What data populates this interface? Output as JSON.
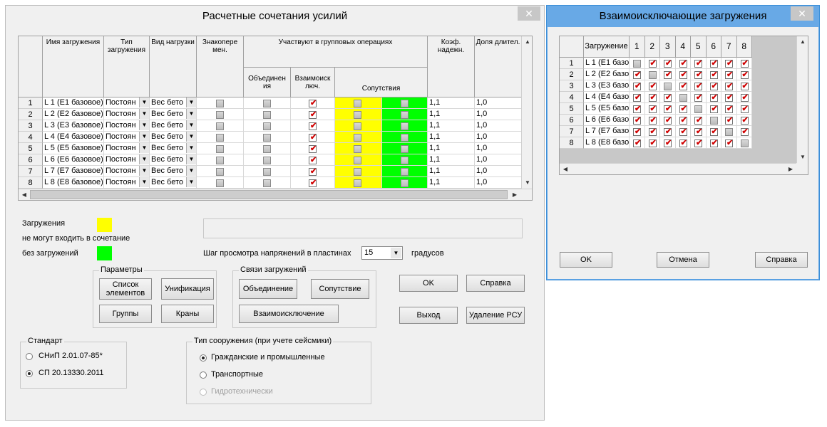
{
  "main": {
    "title": "Расчетные сочетания усилий",
    "close": "✕",
    "headers": {
      "name": "Имя загружения",
      "type": "Тип загружения",
      "kind": "Вид нагрузки",
      "sign": "Знакопере мен.",
      "group": "Участвуют в групповых операциях",
      "union": "Объединен ия",
      "excl": "Взаимоиск люч.",
      "accomp": "Сопутствия",
      "coef": "Коэф. надежн.",
      "dur": "Доля длител."
    },
    "rows": [
      {
        "num": "1",
        "name": "L 1 (E1 базовое)",
        "type": "Постоян",
        "kind": "Вес бето",
        "coef": "1,1",
        "dur": "1,0"
      },
      {
        "num": "2",
        "name": "L 2 (E2 базовое)",
        "type": "Постоян",
        "kind": "Вес бето",
        "coef": "1,1",
        "dur": "1,0"
      },
      {
        "num": "3",
        "name": "L 3 (E3 базовое)",
        "type": "Постоян",
        "kind": "Вес бето",
        "coef": "1,1",
        "dur": "1,0"
      },
      {
        "num": "4",
        "name": "L 4 (E4 базовое)",
        "type": "Постоян",
        "kind": "Вес бето",
        "coef": "1,1",
        "dur": "1,0"
      },
      {
        "num": "5",
        "name": "L 5 (E5 базовое)",
        "type": "Постоян",
        "kind": "Вес бето",
        "coef": "1,1",
        "dur": "1,0"
      },
      {
        "num": "6",
        "name": "L 6 (E6 базовое)",
        "type": "Постоян",
        "kind": "Вес бето",
        "coef": "1,1",
        "dur": "1,0"
      },
      {
        "num": "7",
        "name": "L 7 (E7 базовое)",
        "type": "Постоян",
        "kind": "Вес бето",
        "coef": "1,1",
        "dur": "1,0"
      },
      {
        "num": "8",
        "name": "L 8 (E8 базовое)",
        "type": "Постоян",
        "kind": "Вес бето",
        "coef": "1,1",
        "dur": "1,0"
      }
    ],
    "legend": {
      "line1": "Загружения",
      "line2": "не могут входить в сочетание",
      "line3": "без загружений",
      "yellow": "#ffff00",
      "green": "#00ff00"
    },
    "step_label": "Шаг просмотра напряжений в пластинах",
    "step_value": "15",
    "step_unit": "градусов",
    "params_label": "Параметры",
    "btn_list": "Список элементов",
    "btn_unif": "Унификация",
    "btn_groups": "Группы",
    "btn_cranes": "Краны",
    "links_label": "Связи загружений",
    "btn_union": "Объединение",
    "btn_accomp": "Сопутствие",
    "btn_excl": "Взаимоисключение",
    "btn_ok": "OK",
    "btn_help": "Справка",
    "btn_exit": "Выход",
    "btn_delete": "Удаление РСУ",
    "standard_label": "Стандарт",
    "std1": "СНиП 2.01.07-85*",
    "std2": "СП 20.13330.2011",
    "struct_label": "Тип сооружения (при учете сейсмики)",
    "st1": "Гражданские и промышленные",
    "st2": "Транспортные",
    "st3": "Гидротехнически"
  },
  "excl_dialog": {
    "title": "Взаимоисключающие загружения",
    "close": "✕",
    "col_header": "Загружение",
    "cols": [
      "1",
      "2",
      "3",
      "4",
      "5",
      "6",
      "7",
      "8"
    ],
    "rows": [
      {
        "num": "1",
        "name": "L 1 (E1 базо"
      },
      {
        "num": "2",
        "name": "L 2 (E2 базо"
      },
      {
        "num": "3",
        "name": "L 3 (E3 базо"
      },
      {
        "num": "4",
        "name": "L 4 (E4 базо"
      },
      {
        "num": "5",
        "name": "L 5 (E5 базо"
      },
      {
        "num": "6",
        "name": "L 6 (E6 базо"
      },
      {
        "num": "7",
        "name": "L 7 (E7 базо"
      },
      {
        "num": "8",
        "name": "L 8 (E8 базо"
      }
    ],
    "btn_ok": "OK",
    "btn_cancel": "Отмена",
    "btn_help": "Справка"
  }
}
